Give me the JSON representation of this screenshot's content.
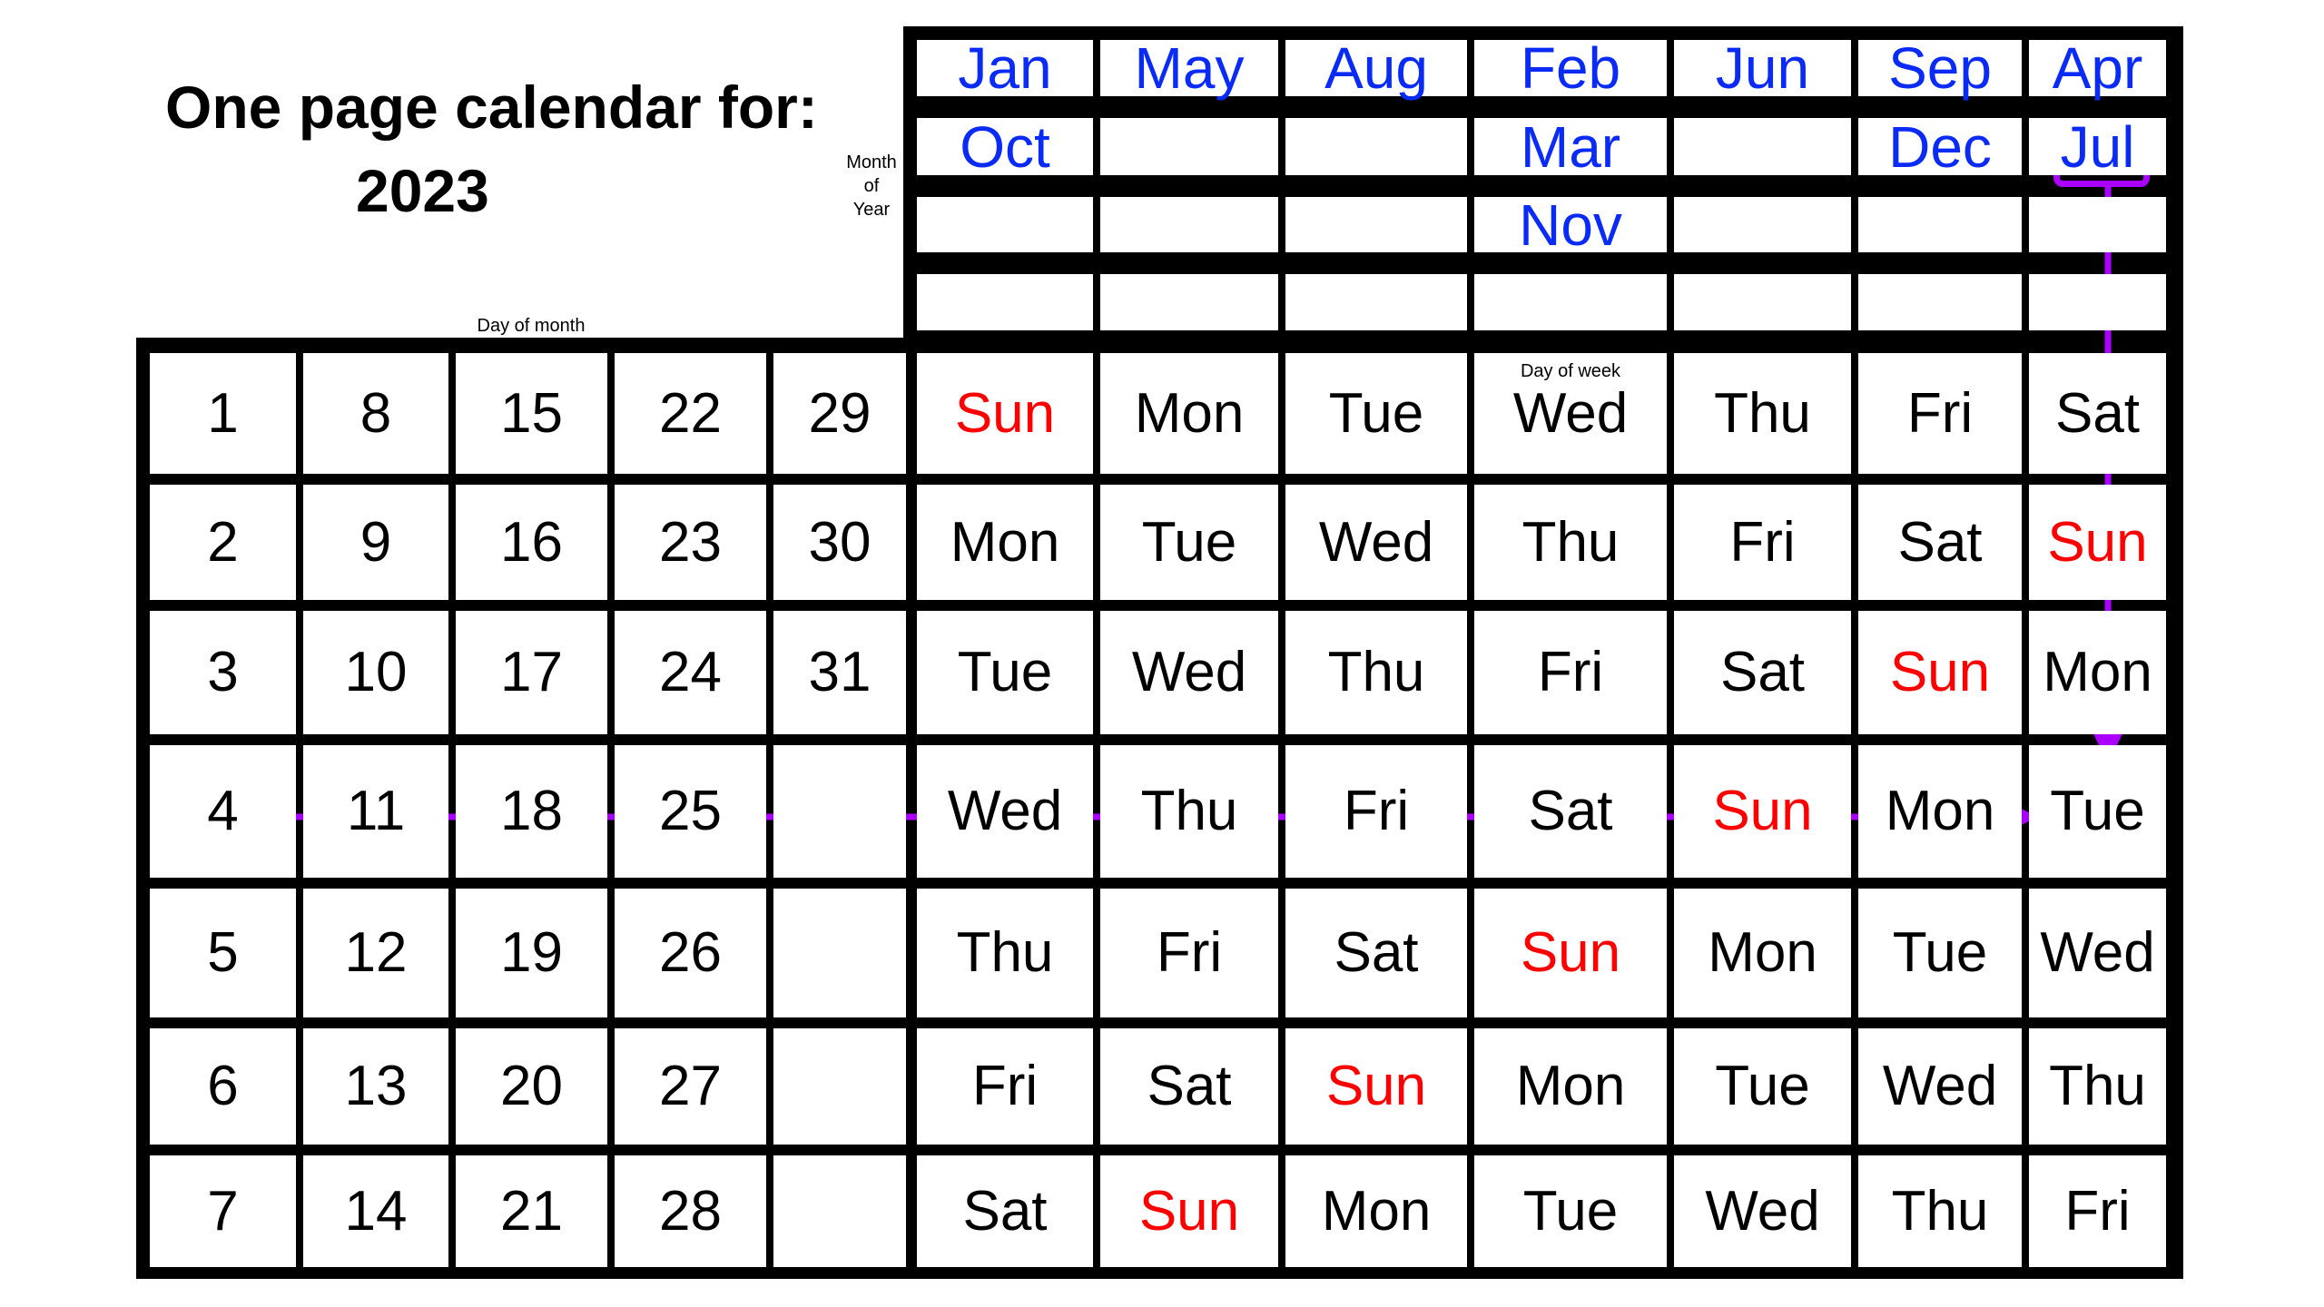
{
  "header": {
    "title_line1": "One page calendar for:",
    "title_line2": "2023"
  },
  "labels": {
    "month_of_year": [
      "Month",
      "of",
      "Year"
    ],
    "day_of_month": "Day of month",
    "day_of_week": "Day of week"
  },
  "colors": {
    "month_text": "#0a2bf5",
    "sunday_text": "#ff0000",
    "highlight": "#aa00ff",
    "grid": "#000000"
  },
  "month_table": [
    [
      "Jan",
      "May",
      "Aug",
      "Feb",
      "Jun",
      "Sep",
      "Apr"
    ],
    [
      "Oct",
      "",
      "",
      "Mar",
      "",
      "Dec",
      "Jul"
    ],
    [
      "",
      "",
      "",
      "Nov",
      "",
      "",
      ""
    ],
    [
      "",
      "",
      "",
      "",
      "",
      "",
      ""
    ]
  ],
  "day_of_month_table": [
    [
      "1",
      "8",
      "15",
      "22",
      "29"
    ],
    [
      "2",
      "9",
      "16",
      "23",
      "30"
    ],
    [
      "3",
      "10",
      "17",
      "24",
      "31"
    ],
    [
      "4",
      "11",
      "18",
      "25",
      ""
    ],
    [
      "5",
      "12",
      "19",
      "26",
      ""
    ],
    [
      "6",
      "13",
      "20",
      "27",
      ""
    ],
    [
      "7",
      "14",
      "21",
      "28",
      ""
    ]
  ],
  "weekday_table": [
    [
      "Sun",
      "Mon",
      "Tue",
      "Wed",
      "Thu",
      "Fri",
      "Sat"
    ],
    [
      "Mon",
      "Tue",
      "Wed",
      "Thu",
      "Fri",
      "Sat",
      "Sun"
    ],
    [
      "Tue",
      "Wed",
      "Thu",
      "Fri",
      "Sat",
      "Sun",
      "Mon"
    ],
    [
      "Wed",
      "Thu",
      "Fri",
      "Sat",
      "Sun",
      "Mon",
      "Tue"
    ],
    [
      "Thu",
      "Fri",
      "Sat",
      "Sun",
      "Mon",
      "Tue",
      "Wed"
    ],
    [
      "Fri",
      "Sat",
      "Sun",
      "Mon",
      "Tue",
      "Wed",
      "Thu"
    ],
    [
      "Sat",
      "Sun",
      "Mon",
      "Tue",
      "Wed",
      "Thu",
      "Fri"
    ]
  ],
  "example_lookup": {
    "month": "Jul",
    "day": "4",
    "result_weekday": "Tue"
  }
}
